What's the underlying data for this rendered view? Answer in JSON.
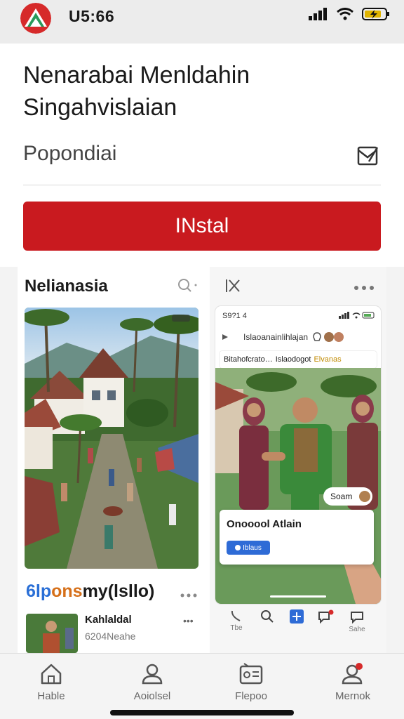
{
  "status_bar": {
    "time": "U5:66",
    "battery_level": 0.7
  },
  "header": {
    "title": "Nenarabai Menldahin Singahvislaian",
    "subtitle": "Popondiai",
    "install_label": "INstal",
    "accent_color": "#c91a1f"
  },
  "left_card": {
    "title": "Nelianasia",
    "section_title_parts": [
      "6lp",
      "ons",
      "my(lsllo)"
    ],
    "list_item": {
      "title": "Kahlaldal",
      "subtitle": "6204Neahe",
      "more": "•••"
    }
  },
  "right_card": {
    "phone": {
      "status_time": "S9?1 4",
      "search_text": "Islaoanainlihlajan",
      "chips": [
        "Bitahofcrato…",
        "Islaodogot",
        "Elvanas"
      ],
      "badge_text": "Soam",
      "popup_title": "Onooool Atlain",
      "popup_button": "Iblaus"
    },
    "mini_nav_labels": [
      "Tbe",
      "",
      "",
      "",
      "Sahe"
    ]
  },
  "bottom_nav": {
    "items": [
      {
        "label": "Hable",
        "icon": "home-icon"
      },
      {
        "label": "Aoiolsel",
        "icon": "person-icon"
      },
      {
        "label": "Flepoo",
        "icon": "radio-icon"
      },
      {
        "label": "Mernok",
        "icon": "profile-notification-icon"
      }
    ]
  }
}
